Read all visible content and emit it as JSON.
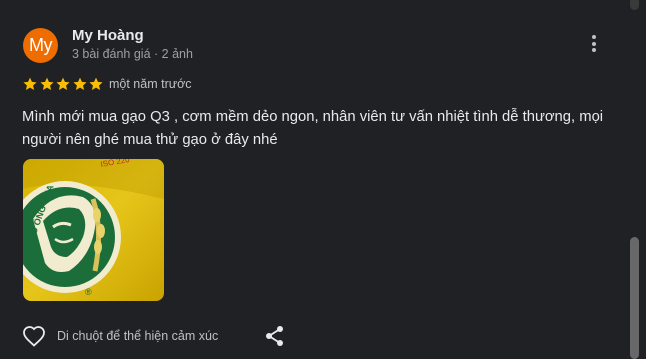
{
  "review": {
    "avatar_initials": "My",
    "avatar_color": "#ef6c00",
    "author_name": "My Hoàng",
    "author_meta": "3 bài đánh giá · 2 ảnh",
    "rating": 5,
    "rating_max": 5,
    "time_ago": "một năm trước",
    "text": "Mình mới mua gạo Q3 , cơm mềm dẻo ngon, nhân viên tư vấn nhiệt tình dễ thương, mọi người nên ghé mua thử gạo ở đây nhé",
    "star_color": "#fbbc04"
  },
  "photo": {
    "bag_text_iso": "ISO 220",
    "bag_brand": "GẠO ÔNG CUA",
    "bag_origin": "VIET NAM",
    "bag_mark": "®"
  },
  "actions": {
    "react_label": "Di chuột để thể hiện cảm xúc",
    "heart_icon": "heart-outline-icon",
    "share_icon": "share-icon"
  }
}
